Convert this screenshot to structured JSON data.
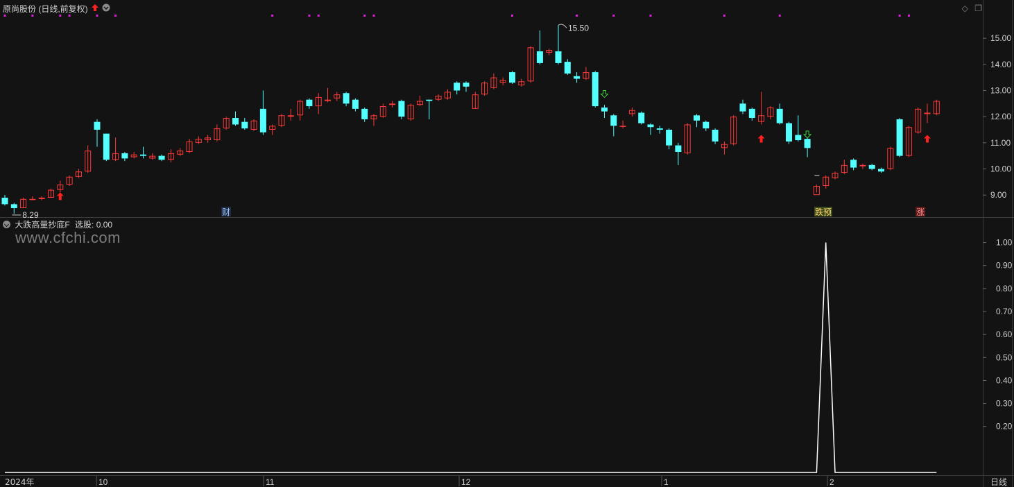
{
  "header": {
    "stock_title": "原尚股份 (日线,前复权)",
    "indicator_title": "大跌高量抄底F",
    "indicator_value": "选股: 0.00"
  },
  "watermark": "www.cfchi.com",
  "x_axis": {
    "year_label": "2024年",
    "months": [
      "10",
      "11",
      "12",
      "1",
      "2"
    ],
    "period_label": "日线"
  },
  "markers": {
    "finance": "财",
    "fall_pre": "跌预",
    "rise": "涨"
  },
  "chart_data": [
    {
      "type": "candlestick",
      "ylim": [
        8.5,
        15.8
      ],
      "yticks": [
        "15.00",
        "14.00",
        "13.00",
        "12.00",
        "11.00",
        "10.00",
        "9.00"
      ],
      "high_label": "15.50",
      "low_label": "8.29",
      "colors": {
        "up": "#ff3b3b",
        "down": "#54ffff"
      },
      "candles": [
        [
          8.9,
          8.65,
          9.0,
          8.6
        ],
        [
          8.65,
          8.5,
          8.7,
          8.29
        ],
        [
          8.5,
          8.85,
          8.9,
          8.5
        ],
        [
          8.85,
          8.85,
          8.95,
          8.8
        ],
        [
          8.85,
          8.9,
          8.95,
          8.8
        ],
        [
          8.9,
          9.2,
          9.25,
          8.9
        ],
        [
          9.2,
          9.4,
          9.55,
          9.1
        ],
        [
          9.4,
          9.7,
          9.75,
          9.35
        ],
        [
          9.7,
          9.9,
          10.0,
          9.65
        ],
        [
          9.9,
          10.7,
          10.9,
          9.85
        ],
        [
          11.8,
          11.5,
          11.9,
          10.85
        ],
        [
          11.35,
          10.35,
          11.35,
          10.3
        ],
        [
          10.35,
          10.6,
          11.2,
          10.3
        ],
        [
          10.6,
          10.4,
          10.65,
          10.3
        ],
        [
          10.45,
          10.55,
          10.65,
          10.4
        ],
        [
          10.55,
          10.5,
          10.85,
          10.4
        ],
        [
          10.4,
          10.5,
          10.6,
          10.35
        ],
        [
          10.5,
          10.35,
          10.55,
          10.3
        ],
        [
          10.35,
          10.6,
          10.75,
          10.25
        ],
        [
          10.55,
          10.7,
          10.8,
          10.5
        ],
        [
          10.65,
          11.05,
          11.15,
          10.6
        ],
        [
          11.0,
          11.15,
          11.25,
          10.95
        ],
        [
          11.1,
          11.2,
          11.3,
          11.0
        ],
        [
          11.1,
          11.55,
          11.7,
          11.05
        ],
        [
          11.55,
          11.95,
          12.0,
          11.5
        ],
        [
          11.95,
          11.7,
          12.2,
          11.65
        ],
        [
          11.8,
          11.55,
          11.95,
          11.5
        ],
        [
          11.5,
          11.85,
          11.9,
          11.45
        ],
        [
          12.3,
          11.4,
          13.0,
          11.3
        ],
        [
          11.5,
          11.65,
          11.7,
          11.3
        ],
        [
          11.65,
          12.05,
          12.1,
          11.6
        ],
        [
          12.0,
          12.05,
          12.3,
          11.85
        ],
        [
          12.05,
          12.6,
          12.65,
          11.85
        ],
        [
          12.65,
          12.4,
          12.7,
          12.3
        ],
        [
          12.4,
          12.75,
          12.9,
          12.1
        ],
        [
          12.6,
          12.65,
          13.1,
          12.55
        ],
        [
          12.7,
          12.85,
          12.95,
          12.6
        ],
        [
          12.9,
          12.5,
          12.95,
          12.4
        ],
        [
          12.65,
          12.3,
          12.7,
          12.2
        ],
        [
          12.3,
          11.9,
          12.35,
          11.8
        ],
        [
          11.9,
          12.05,
          12.1,
          11.65
        ],
        [
          12.0,
          12.4,
          12.5,
          11.95
        ],
        [
          12.45,
          12.5,
          12.6,
          12.35
        ],
        [
          12.6,
          12.0,
          12.65,
          11.9
        ],
        [
          11.9,
          12.45,
          12.5,
          11.85
        ],
        [
          12.45,
          12.6,
          12.8,
          12.4
        ],
        [
          12.65,
          12.6,
          12.65,
          11.9
        ],
        [
          12.65,
          12.8,
          12.85,
          12.6
        ],
        [
          12.7,
          12.95,
          13.05,
          12.65
        ],
        [
          13.3,
          13.0,
          13.35,
          12.85
        ],
        [
          13.3,
          13.15,
          13.35,
          12.95
        ],
        [
          12.3,
          12.85,
          12.95,
          12.3
        ],
        [
          12.85,
          13.3,
          13.35,
          12.8
        ],
        [
          13.1,
          13.5,
          13.65,
          13.05
        ],
        [
          13.3,
          13.4,
          13.5,
          13.2
        ],
        [
          13.7,
          13.3,
          13.75,
          13.25
        ],
        [
          13.2,
          13.35,
          13.45,
          13.15
        ],
        [
          13.35,
          14.65,
          14.7,
          13.3
        ],
        [
          14.5,
          14.05,
          15.3,
          14.0
        ],
        [
          14.45,
          14.55,
          14.6,
          14.35
        ],
        [
          14.5,
          14.05,
          15.5,
          14.0
        ],
        [
          14.1,
          13.65,
          14.2,
          13.6
        ],
        [
          13.55,
          13.45,
          13.7,
          13.3
        ],
        [
          13.45,
          13.7,
          13.9,
          13.4
        ],
        [
          13.7,
          12.4,
          13.75,
          12.35
        ],
        [
          12.35,
          12.2,
          12.45,
          11.95
        ],
        [
          12.05,
          11.65,
          12.1,
          11.25
        ],
        [
          11.65,
          11.65,
          11.85,
          11.55
        ],
        [
          12.1,
          12.25,
          12.35,
          12.0
        ],
        [
          12.15,
          11.75,
          12.2,
          11.7
        ],
        [
          11.7,
          11.6,
          11.75,
          11.3
        ],
        [
          11.55,
          11.5,
          11.65,
          11.35
        ],
        [
          11.5,
          10.9,
          11.55,
          10.75
        ],
        [
          10.9,
          10.65,
          11.0,
          10.15
        ],
        [
          10.6,
          11.7,
          11.75,
          10.55
        ],
        [
          12.05,
          11.85,
          12.1,
          11.6
        ],
        [
          11.8,
          11.55,
          11.85,
          11.45
        ],
        [
          11.5,
          11.05,
          11.55,
          10.95
        ],
        [
          10.8,
          10.95,
          11.05,
          10.55
        ],
        [
          10.95,
          12.0,
          12.05,
          10.9
        ],
        [
          12.5,
          12.2,
          12.65,
          12.1
        ],
        [
          12.3,
          11.95,
          12.35,
          11.85
        ],
        [
          11.8,
          12.05,
          12.95,
          11.7
        ],
        [
          12.0,
          12.35,
          12.4,
          11.9
        ],
        [
          12.3,
          11.75,
          12.5,
          11.7
        ],
        [
          11.75,
          11.05,
          11.8,
          10.95
        ],
        [
          11.3,
          11.1,
          12.05,
          11.05
        ],
        [
          11.15,
          10.8,
          11.2,
          10.45
        ],
        [
          9.0,
          9.35,
          9.4,
          9.1
        ],
        [
          9.35,
          9.7,
          9.75,
          9.25
        ],
        [
          9.65,
          9.85,
          9.9,
          9.6
        ],
        [
          9.85,
          10.15,
          10.35,
          9.8
        ],
        [
          10.35,
          10.05,
          10.4,
          9.95
        ],
        [
          10.1,
          10.15,
          10.2,
          10.0
        ],
        [
          10.15,
          10.0,
          10.2,
          9.95
        ],
        [
          10.0,
          9.9,
          10.05,
          9.85
        ],
        [
          10.0,
          10.8,
          10.85,
          9.95
        ],
        [
          11.9,
          10.5,
          11.95,
          10.45
        ],
        [
          10.5,
          11.6,
          11.65,
          10.45
        ],
        [
          11.4,
          12.3,
          12.35,
          11.35
        ],
        [
          12.1,
          12.15,
          12.5,
          11.75
        ],
        [
          12.1,
          12.6,
          12.65,
          12.05
        ]
      ],
      "flag_days": [
        0,
        3,
        6,
        7,
        10,
        12,
        29,
        33,
        34,
        39,
        40,
        55,
        62,
        66,
        70,
        78,
        84,
        97,
        98
      ]
    },
    {
      "type": "line",
      "name": "选股",
      "ylim": [
        0,
        1.05
      ],
      "yticks": [
        "1.00",
        "0.90",
        "0.80",
        "0.70",
        "0.60",
        "0.50",
        "0.40",
        "0.30",
        "0.20"
      ],
      "values": [
        0,
        0,
        0,
        0,
        0,
        0,
        0,
        0,
        0,
        0,
        0,
        0,
        0,
        0,
        0,
        0,
        0,
        0,
        0,
        0,
        0,
        0,
        0,
        0,
        0,
        0,
        0,
        0,
        0,
        0,
        0,
        0,
        0,
        0,
        0,
        0,
        0,
        0,
        0,
        0,
        0,
        0,
        0,
        0,
        0,
        0,
        0,
        0,
        0,
        0,
        0,
        0,
        0,
        0,
        0,
        0,
        0,
        0,
        0,
        0,
        0,
        0,
        0,
        0,
        0,
        0,
        0,
        0,
        0,
        0,
        0,
        0,
        0,
        0,
        0,
        0,
        0,
        0,
        0,
        0,
        0,
        0,
        0,
        0,
        0,
        0,
        0,
        0,
        0,
        1,
        0,
        0,
        0,
        0,
        0,
        0,
        0,
        0,
        0,
        0,
        0,
        0
      ],
      "color": "#ffffff"
    }
  ]
}
